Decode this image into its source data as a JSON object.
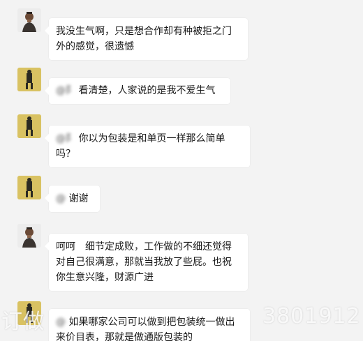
{
  "messages": [
    {
      "sender": "",
      "avatar": "man-avatar",
      "mention": "",
      "text": "我没生气啊，只是想合作却有种被拒之门外的感觉，很遗憾"
    },
    {
      "sender": "",
      "avatar": "gold-avatar",
      "mention": "@阝",
      "text": "看清楚，人家说的是我不爱生气"
    },
    {
      "sender": "",
      "avatar": "gold-avatar",
      "mention": "@阝",
      "text": "你以为包装是和单页一样那么简单吗？"
    },
    {
      "sender": "",
      "avatar": "gold-avatar",
      "mention": "@",
      "text": "谢谢"
    },
    {
      "sender": "",
      "avatar": "man-avatar",
      "mention": "",
      "text": "呵呵　细节定成败，工作做的不细还觉得对自己很满意，那就当我放了些屁。也祝你生意兴隆，财源广进"
    },
    {
      "sender": "",
      "avatar": "gold-avatar",
      "mention": "@",
      "text": "如果哪家公司可以做到把包装统一做出来价目表，那就是做通版包装的"
    }
  ],
  "watermark": {
    "left": "订做",
    "right": "3801912"
  }
}
